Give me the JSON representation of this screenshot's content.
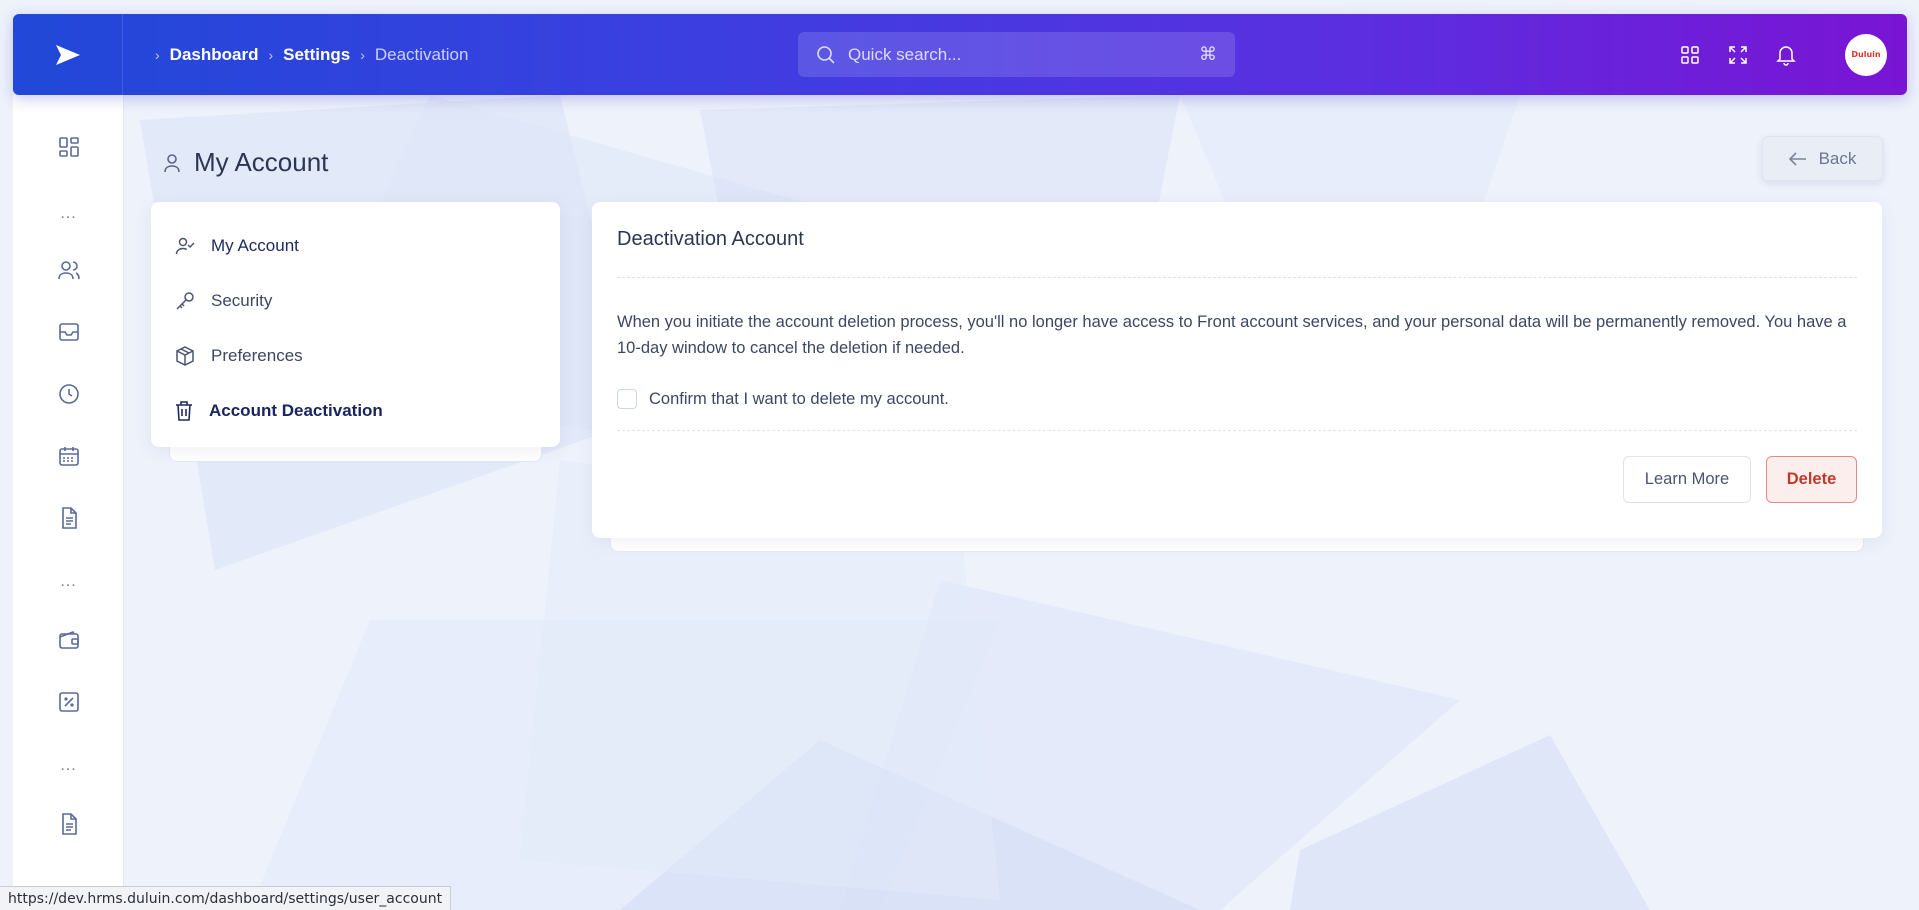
{
  "topbar": {
    "breadcrumb": [
      {
        "label": "Dashboard"
      },
      {
        "label": "Settings"
      },
      {
        "label": "Deactivation"
      }
    ],
    "search": {
      "placeholder": "Quick search...",
      "shortcut": "⌘"
    },
    "avatar_text": "Duluin"
  },
  "page": {
    "title": "My Account",
    "back_label": "Back"
  },
  "settings_menu": {
    "items": [
      {
        "label": "My Account",
        "icon": "user-check-icon"
      },
      {
        "label": "Security",
        "icon": "key-icon"
      },
      {
        "label": "Preferences",
        "icon": "package-icon"
      },
      {
        "label": "Account Deactivation",
        "icon": "trash-icon"
      }
    ]
  },
  "deactivation": {
    "title": "Deactivation Account",
    "description": "When you initiate the account deletion process, you'll no longer have access to Front account services, and your personal data will be permanently removed. You have a 10-day window to cancel the deletion if needed.",
    "confirm_label": "Confirm that I want to delete my account.",
    "confirm_checked": false,
    "learn_more_label": "Learn More",
    "delete_label": "Delete"
  },
  "sidebar": {
    "icons": [
      "dashboard-icon",
      "more-dots",
      "users-icon",
      "inbox-icon",
      "clock-icon",
      "calendar-icon",
      "document-icon",
      "more-dots",
      "wallet-icon",
      "percent-icon",
      "more-dots",
      "report-icon"
    ],
    "dots": "..."
  },
  "status_bar": {
    "url": "https://dev.hrms.duluin.com/dashboard/settings/user_account"
  },
  "colors": {
    "accent_start": "#2148d8",
    "accent_end": "#7a14d4",
    "danger": "#c0392b"
  }
}
